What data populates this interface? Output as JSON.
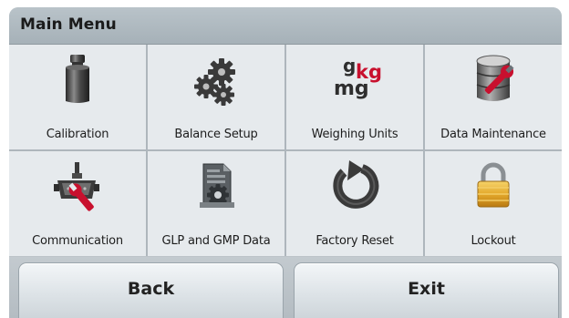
{
  "header": {
    "title": "Main Menu"
  },
  "menu": {
    "tiles": [
      {
        "label": "Calibration",
        "icon": "weight-icon"
      },
      {
        "label": "Balance Setup",
        "icon": "gears-icon"
      },
      {
        "label": "Weighing Units",
        "icon": "units-icon",
        "icon_text": {
          "g": "g",
          "kg": "kg",
          "mg": "mg"
        }
      },
      {
        "label": "Data Maintenance",
        "icon": "database-wrench-icon"
      },
      {
        "label": "Communication",
        "icon": "connector-wrench-icon"
      },
      {
        "label": "GLP and GMP Data",
        "icon": "document-gear-icon"
      },
      {
        "label": "Factory Reset",
        "icon": "reset-arrow-icon"
      },
      {
        "label": "Lockout",
        "icon": "padlock-icon"
      }
    ]
  },
  "footer": {
    "back_label": "Back",
    "exit_label": "Exit"
  },
  "colors": {
    "title_bar": "#aab4ba",
    "tile_background": "#e6eaed",
    "units_accent": "#c8102e",
    "lock_gold": "#e3a82b",
    "wrench_red": "#c8102e"
  }
}
